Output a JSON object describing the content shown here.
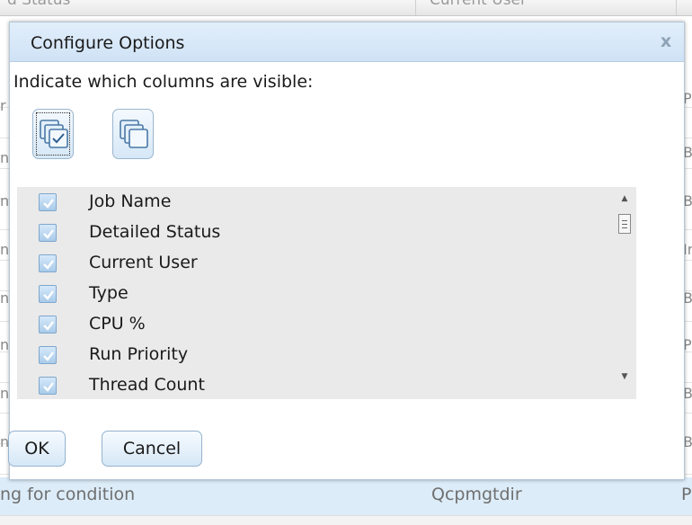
{
  "background": {
    "header": {
      "col1": "d Status",
      "col2": "Current User"
    },
    "left_edge_glyphs": [
      "r",
      "n",
      "n",
      "n",
      "n",
      "n",
      "n",
      "n",
      "n"
    ],
    "right_edge_glyphs": [
      "P",
      "B",
      "B",
      "Ir",
      "B",
      "P",
      "B",
      "B",
      "B"
    ],
    "bottom_row": {
      "status": "ng for condition",
      "user": "Qcpmgtdir",
      "edge": "P"
    }
  },
  "dialog": {
    "title": "Configure Options",
    "close_glyph": "x",
    "prompt": "Indicate which columns are visible:",
    "select_all_icon": "select-all-icon",
    "deselect_all_icon": "deselect-all-icon",
    "columns": [
      {
        "label": "Job Name",
        "checked": true
      },
      {
        "label": "Detailed Status",
        "checked": true
      },
      {
        "label": "Current User",
        "checked": true
      },
      {
        "label": "Type",
        "checked": true
      },
      {
        "label": "CPU %",
        "checked": true
      },
      {
        "label": "Run Priority",
        "checked": true
      },
      {
        "label": "Thread Count",
        "checked": true
      }
    ],
    "scroll_up_glyph": "▲",
    "scroll_down_glyph": "▼",
    "ok_label": "OK",
    "cancel_label": "Cancel"
  },
  "colors": {
    "titlebar": "#cfe2f5",
    "checkbox": "#a9cbea",
    "selected_row": "#dcecf8"
  }
}
